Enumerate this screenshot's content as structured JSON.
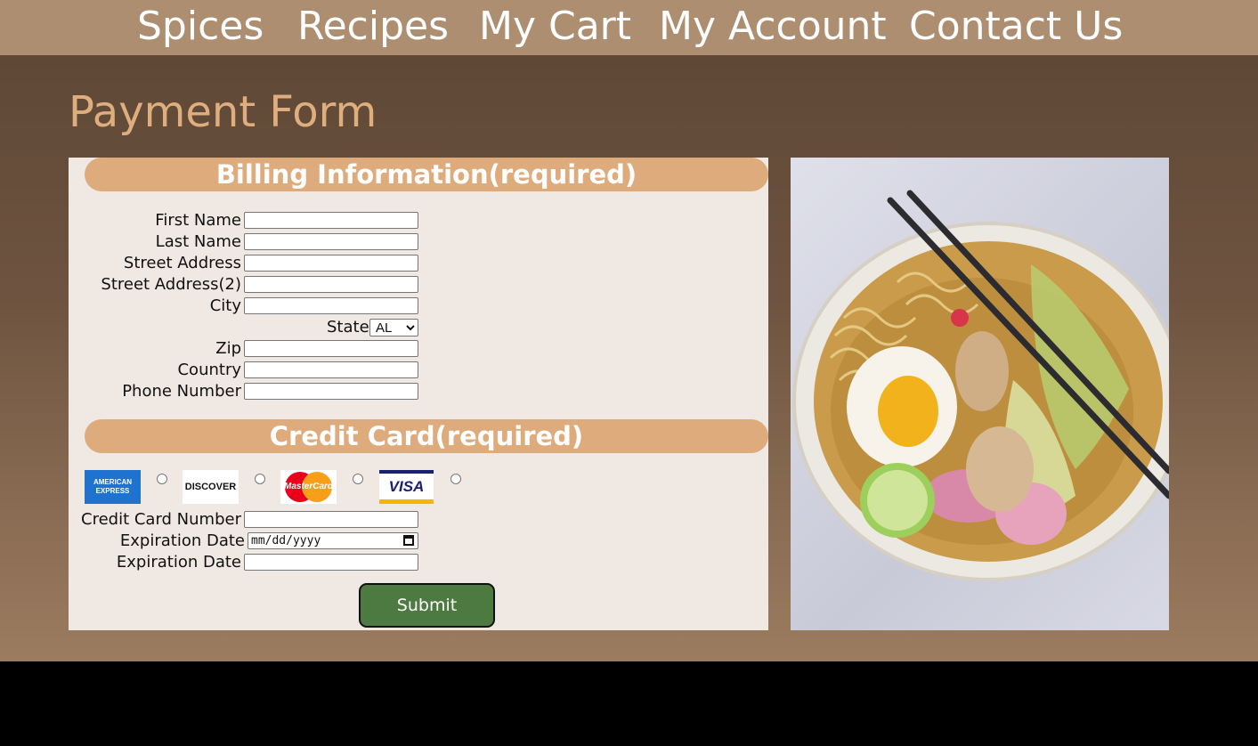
{
  "nav": {
    "items": [
      "Spices",
      "Recipes",
      "My Cart",
      "My Account",
      "Contact Us"
    ]
  },
  "page": {
    "title": "Payment Form"
  },
  "billing": {
    "heading": "Billing Information(required)",
    "fields": [
      "First Name",
      "Last Name",
      "Street Address",
      "Street Address(2)",
      "City"
    ],
    "state_label": "State",
    "state_value": "AL",
    "fields_after": [
      "Zip",
      "Country",
      "Phone Number"
    ]
  },
  "credit": {
    "heading": "Credit Card(required)",
    "cards": [
      "AMERICAN EXPRESS",
      "DISCOVER",
      "MasterCard",
      "VISA"
    ],
    "number_label": "Credit Card Number",
    "expiration_label": "Expiration Date",
    "expiration_placeholder": "mm/dd/yyyy",
    "expiration_label_2": "Expiration Date"
  },
  "submit_label": "Submit",
  "photo": {
    "subject": "ramen-bowl"
  },
  "colors": {
    "nav": "#ad8e70",
    "title": "#dfae7e",
    "section_head": "#deac7c",
    "panel": "#f0e9e3",
    "submit": "#4d7a41"
  }
}
